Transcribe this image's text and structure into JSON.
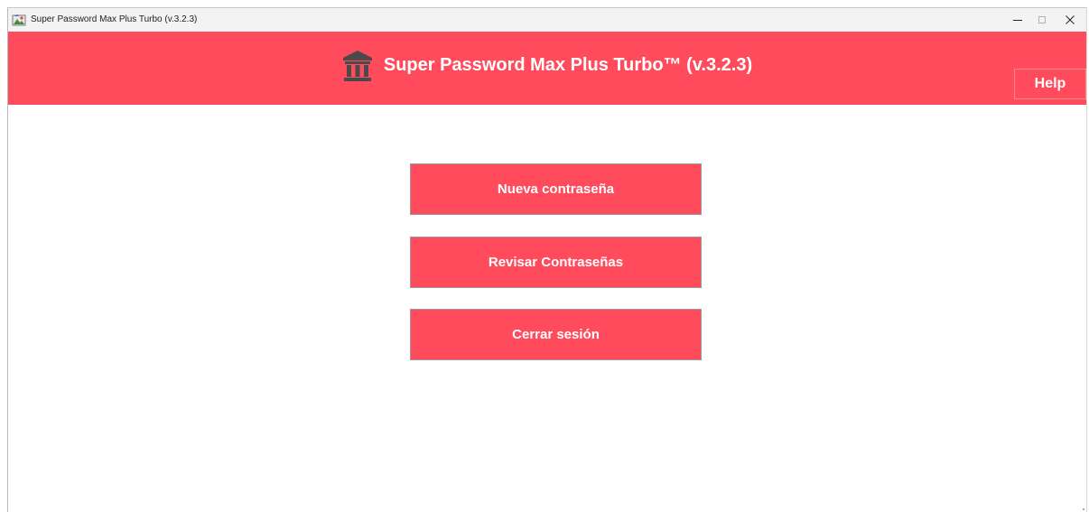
{
  "window": {
    "title": "Super Password Max Plus Turbo (v.3.2.3)",
    "controls": {
      "minimize_icon": "minimize-icon",
      "maximize_icon": "maximize-icon",
      "close_icon": "close-icon"
    }
  },
  "header": {
    "icon": "bank-icon",
    "title": "Super Password Max Plus Turbo™ (v.3.2.3)",
    "help_label": "Help"
  },
  "main": {
    "buttons": [
      {
        "label": "Nueva contraseña"
      },
      {
        "label": "Revisar Contraseñas"
      },
      {
        "label": "Cerrar sesión"
      }
    ]
  },
  "colors": {
    "accent": "#ff4b5c",
    "text_on_accent": "#ffffff",
    "titlebar": "#f3f3f3",
    "icon_dark": "#4a4a4a"
  }
}
